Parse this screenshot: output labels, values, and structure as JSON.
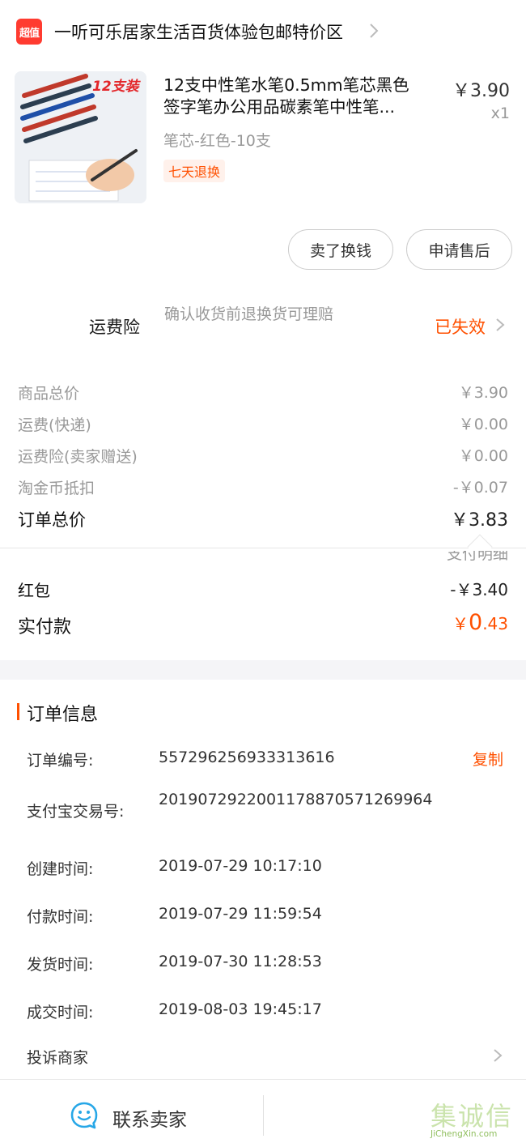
{
  "shop": {
    "badge": "超值",
    "name": "一听可乐居家生活百货体验包邮特价区"
  },
  "product": {
    "image_badge": "12支装",
    "title_line1": "12支中性笔水笔0.5mm笔芯黑色",
    "title_line2": "签字笔办公用品碳素笔中性笔...",
    "price": "￥3.90",
    "quantity": "x1",
    "sku": "笔芯-红色-10支",
    "tag": "七天退换"
  },
  "actions": {
    "sell_exchange": "卖了换钱",
    "apply_after_sale": "申请售后"
  },
  "insurance": {
    "label": "运费险",
    "description": "确认收货前退换货可理赔",
    "status": "已失效"
  },
  "fees": [
    {
      "label": "商品总价",
      "value": "￥3.90"
    },
    {
      "label": "运费(快递)",
      "value": "￥0.00"
    },
    {
      "label": "运费险(卖家赠送)",
      "value": "￥0.00"
    },
    {
      "label": "淘金币抵扣",
      "value": "-￥0.07"
    }
  ],
  "order_total": {
    "label": "订单总价",
    "value": "￥3.83"
  },
  "payment_detail_link": "支付明细",
  "red_packet": {
    "label": "红包",
    "value": "-￥3.40"
  },
  "actual_paid": {
    "label": "实付款",
    "currency": "￥",
    "integer": "0",
    "decimal": ".43"
  },
  "order_info": {
    "title": "订单信息",
    "copy_label": "复制",
    "rows": [
      {
        "label": "订单编号:",
        "value": "557296256933313616"
      },
      {
        "label": "支付宝交易号:",
        "value": "2019072922001178870571269964"
      },
      {
        "label": "创建时间:",
        "value": "2019-07-29 10:17:10"
      },
      {
        "label": "付款时间:",
        "value": "2019-07-29 11:59:54"
      },
      {
        "label": "发货时间:",
        "value": "2019-07-30 11:28:53"
      },
      {
        "label": "成交时间:",
        "value": "2019-08-03 19:45:17"
      }
    ],
    "complain": "投诉商家"
  },
  "bottom_bar": {
    "contact_seller": "联系卖家"
  },
  "watermark": {
    "text": "集诚信",
    "url": "JiChengXin.com"
  },
  "colors": {
    "accent": "#ff5000",
    "badge_red": "#ff3b30",
    "muted_text": "#999999",
    "icon_blue": "#27a7e7"
  },
  "icons": {
    "shop_chevron": "chevron-right-icon",
    "insurance_chevron": "chevron-right-icon",
    "complain_chevron": "chevron-right-icon",
    "contact": "chat-bubble-smile-icon"
  }
}
